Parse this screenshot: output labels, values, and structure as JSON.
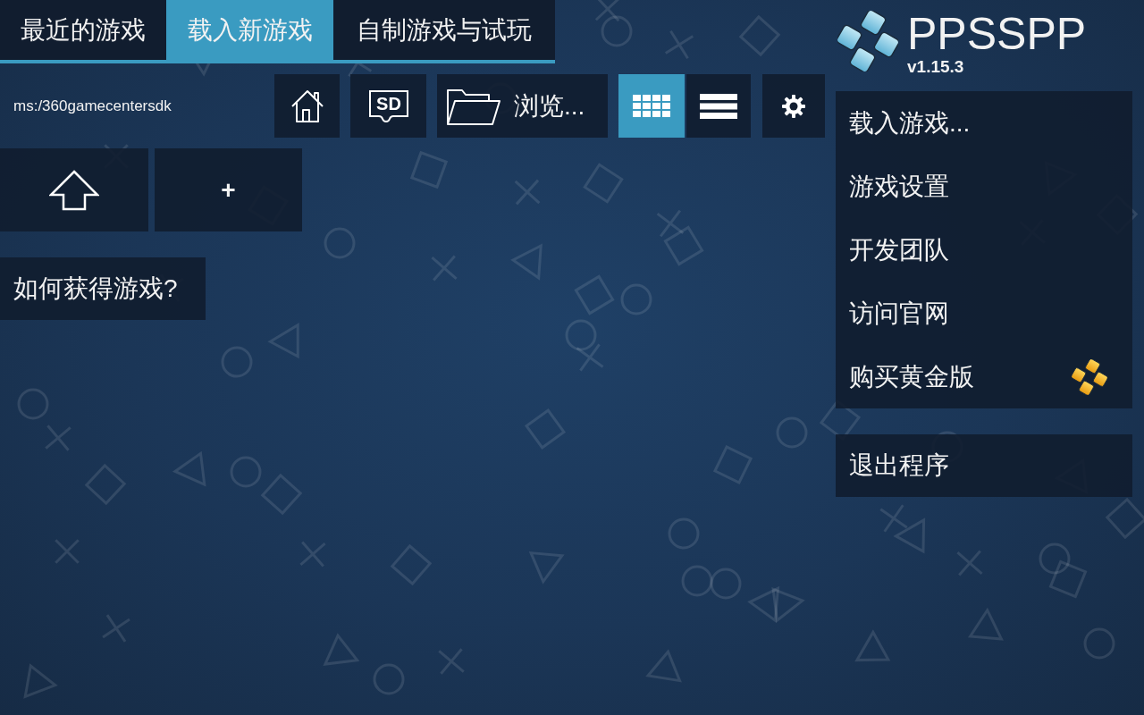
{
  "tabs": [
    {
      "label": "最近的游戏",
      "selected": false
    },
    {
      "label": "载入新游戏",
      "selected": true
    },
    {
      "label": "自制游戏与试玩",
      "selected": false
    }
  ],
  "path": "ms:/360gamecentersdk",
  "location_buttons": [
    {
      "kind": "home"
    },
    {
      "kind": "sd",
      "label": "SD"
    },
    {
      "kind": "browse",
      "label": "浏览..."
    }
  ],
  "view_modes": [
    {
      "kind": "grid",
      "selected": true
    },
    {
      "kind": "list",
      "selected": false
    }
  ],
  "file_buttons": [
    {
      "kind": "up"
    },
    {
      "kind": "add",
      "label": "+"
    }
  ],
  "help_button": {
    "label": "如何获得游戏?"
  },
  "logo": {
    "title": "PPSSPP",
    "version": "v1.15.3"
  },
  "menu": {
    "items": [
      {
        "label": "载入游戏...",
        "kind": "plain"
      },
      {
        "label": "游戏设置",
        "kind": "plain"
      },
      {
        "label": "开发团队",
        "kind": "plain"
      },
      {
        "label": "访问官网",
        "kind": "plain"
      },
      {
        "label": "购买黄金版",
        "kind": "gold"
      }
    ]
  },
  "exit_button": {
    "label": "退出程序"
  }
}
